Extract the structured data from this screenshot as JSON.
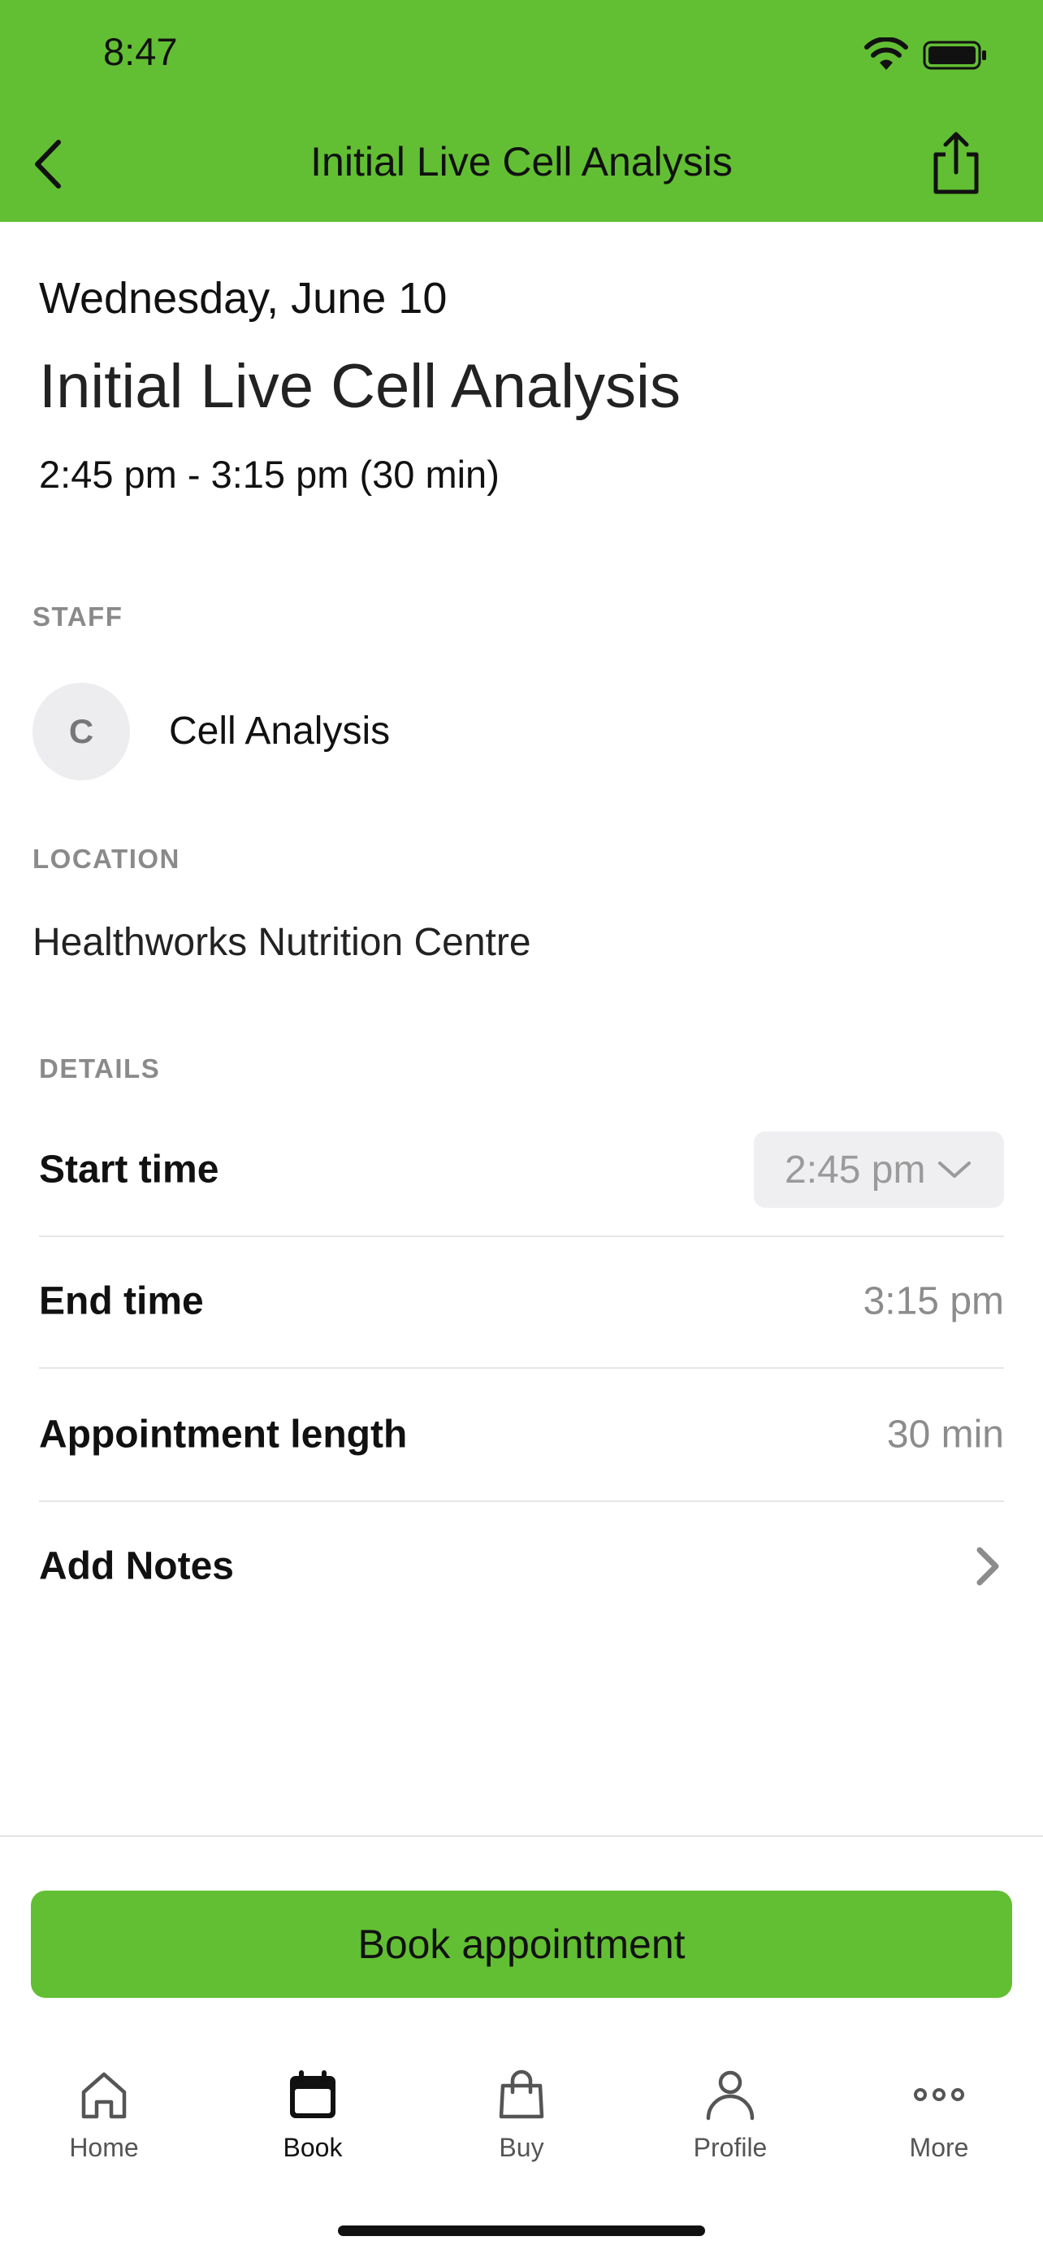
{
  "status_bar": {
    "time": "8:47"
  },
  "nav": {
    "title": "Initial Live Cell Analysis"
  },
  "appointment": {
    "date": "Wednesday, June 10",
    "title": "Initial Live Cell Analysis",
    "time_range": "2:45 pm - 3:15 pm (30 min)"
  },
  "staff": {
    "label": "STAFF",
    "avatar_initial": "C",
    "name": "Cell Analysis"
  },
  "location": {
    "label": "LOCATION",
    "name": "Healthworks Nutrition Centre"
  },
  "details": {
    "label": "DETAILS",
    "start_time_label": "Start time",
    "start_time_value": "2:45 pm",
    "end_time_label": "End time",
    "end_time_value": "3:15 pm",
    "length_label": "Appointment length",
    "length_value": "30 min",
    "notes_label": "Add Notes"
  },
  "book_button": {
    "label": "Book appointment"
  },
  "tabs": [
    {
      "label": "Home",
      "icon": "home-icon"
    },
    {
      "label": "Book",
      "icon": "calendar-icon",
      "active": true
    },
    {
      "label": "Buy",
      "icon": "shopping-bag-icon"
    },
    {
      "label": "Profile",
      "icon": "person-icon"
    },
    {
      "label": "More",
      "icon": "more-dots-icon"
    }
  ],
  "colors": {
    "brand_green": "#62bf33",
    "muted_text": "#8c8c8c",
    "select_bg": "#efeff1"
  }
}
